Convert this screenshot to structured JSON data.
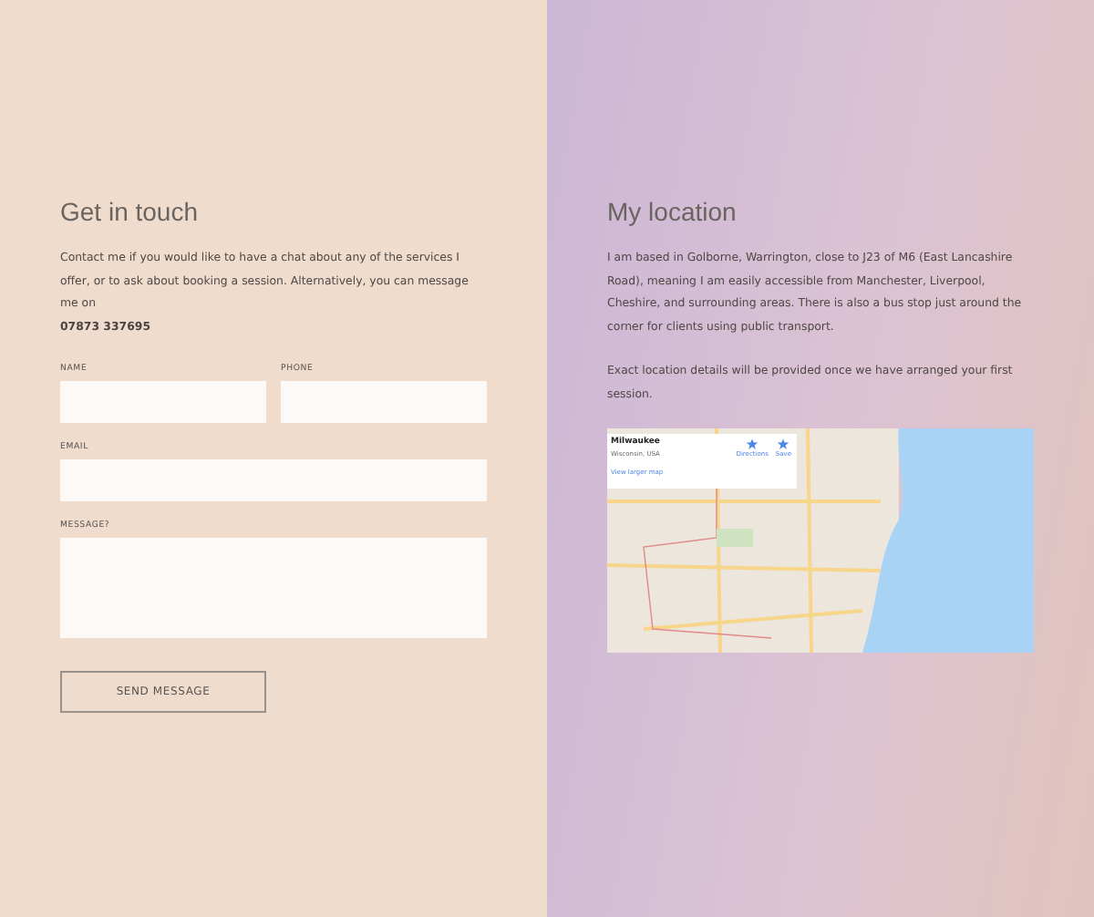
{
  "contact": {
    "title": "Get in touch",
    "intro": "Contact me if you would like to have a chat about any of the services I offer, or to ask about booking a session. Alternatively, you can message me on",
    "phone_number": "07873 337695",
    "fields": [
      {
        "label": "NAME",
        "kind": "input"
      },
      {
        "label": "PHONE",
        "kind": "input"
      },
      {
        "label": "EMAIL",
        "kind": "input"
      },
      {
        "label": "MESSAGE?",
        "kind": "textarea"
      }
    ],
    "button": "SEND MESSAGE"
  },
  "location": {
    "title": "My location",
    "paragraphs": [
      "I am based in Golborne, Warrington, close to J23 of M6 (East Lancashire Road), meaning I am easily accessible from Manchester, Liverpool, Cheshire, and surrounding areas. There is also a bus stop just around the corner for clients using public transport.",
      "Exact location details will be provided once we have arranged your first session."
    ],
    "map": {
      "place": "Milwaukee",
      "region": "Wisconsin, USA",
      "link": "View larger map",
      "actions": [
        "Directions",
        "Save"
      ]
    }
  }
}
